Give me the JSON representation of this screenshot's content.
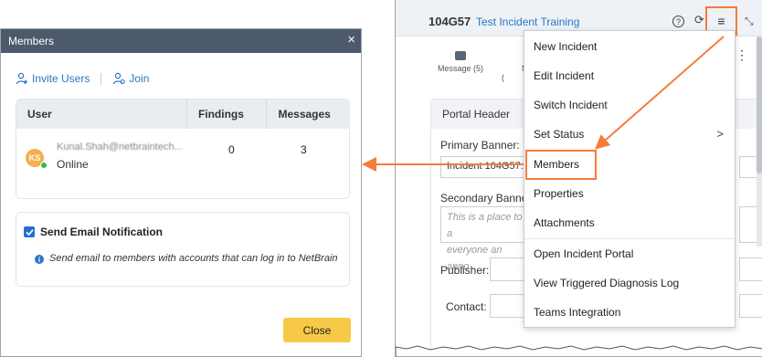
{
  "dialog": {
    "title": "Members",
    "close_glyph": "×",
    "invite_label": "Invite Users",
    "join_label": "Join",
    "columns": [
      "User",
      "Findings",
      "Messages"
    ],
    "member": {
      "initials": "KS",
      "email": "Kunal.Shah@netbraintech...",
      "status": "Online",
      "findings": "0",
      "messages": "3"
    },
    "notify_label": "Send Email Notification",
    "notify_checked": true,
    "notify_info": "Send email to members with accounts that can log in to NetBrain",
    "close_button": "Close"
  },
  "panel": {
    "incident_id": "104G57",
    "incident_name": "Test Incident Training",
    "help_glyph": "?",
    "refresh_glyph": "⟳",
    "menu_glyph": "≡",
    "collapse_glyph": "⤡",
    "tabs": [
      {
        "label": "Message (5)",
        "icon": "message-icon"
      },
      {
        "label": "Map (",
        "icon": "map-icon"
      }
    ],
    "more_glyph": "⋮",
    "portal_header": "Portal Header",
    "primary_banner_label": "Primary Banner:",
    "primary_banner_value": "Incident 104G57:",
    "secondary_banner_label": "Secondary Banner",
    "secondary_banner_placeholder_1": "This is a place to a",
    "secondary_banner_placeholder_2": "everyone an anno",
    "publisher_label": "Publisher:",
    "contact_label": "Contact:"
  },
  "menu": {
    "items": [
      "New Incident",
      "Edit Incident",
      "Switch Incident",
      "Set Status",
      "Members",
      "Properties",
      "Attachments",
      "Open Incident Portal",
      "View Triggered Diagnosis Log",
      "Teams Integration"
    ],
    "submenu_glyph": ">",
    "highlighted": "Members"
  },
  "colors": {
    "accent": "#f47c3c",
    "link": "#2a76c6",
    "dialog_title_bg": "#4d5a6b",
    "close_button_bg": "#f7c948",
    "online": "#3cb44b",
    "avatar": "#f4b04a"
  }
}
